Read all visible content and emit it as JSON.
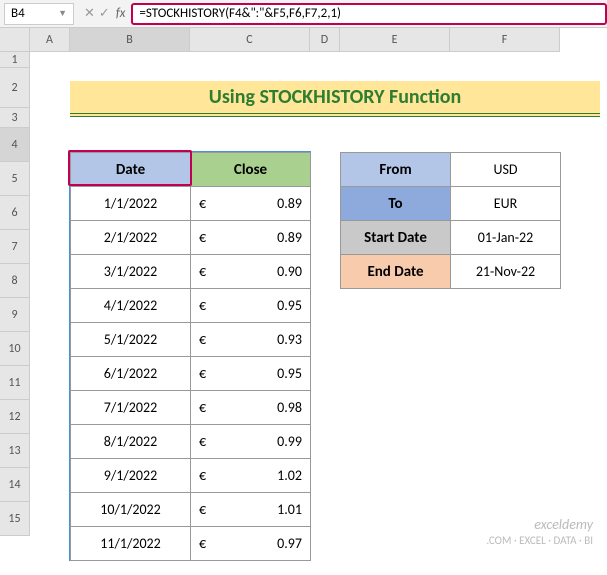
{
  "name_box": "B4",
  "fx_label": "fx",
  "formula": "=STOCKHISTORY(F4&\":\"&F5,F6,F7,2,1)",
  "columns": [
    "A",
    "B",
    "C",
    "D",
    "E",
    "F"
  ],
  "rows": [
    "1",
    "2",
    "3",
    "4",
    "5",
    "6",
    "7",
    "8",
    "9",
    "10",
    "11",
    "12",
    "13",
    "14",
    "15"
  ],
  "title": "Using STOCKHISTORY Function",
  "headers": {
    "date": "Date",
    "close": "Close"
  },
  "currency_symbol": "€",
  "table": [
    {
      "date": "1/1/2022",
      "close": "0.89"
    },
    {
      "date": "2/1/2022",
      "close": "0.89"
    },
    {
      "date": "3/1/2022",
      "close": "0.90"
    },
    {
      "date": "4/1/2022",
      "close": "0.95"
    },
    {
      "date": "5/1/2022",
      "close": "0.93"
    },
    {
      "date": "6/1/2022",
      "close": "0.95"
    },
    {
      "date": "7/1/2022",
      "close": "0.98"
    },
    {
      "date": "8/1/2022",
      "close": "0.99"
    },
    {
      "date": "9/1/2022",
      "close": "1.02"
    },
    {
      "date": "10/1/2022",
      "close": "1.01"
    },
    {
      "date": "11/1/2022",
      "close": "0.97"
    }
  ],
  "info": {
    "from_label": "From",
    "from_value": "USD",
    "to_label": "To",
    "to_value": "EUR",
    "start_label": "Start Date",
    "start_value": "01-Jan-22",
    "end_label": "End Date",
    "end_value": "21-Nov-22"
  },
  "watermark": {
    "brand": "exceldemy",
    "tagline": ".COM · EXCEL · DATA · BI"
  }
}
